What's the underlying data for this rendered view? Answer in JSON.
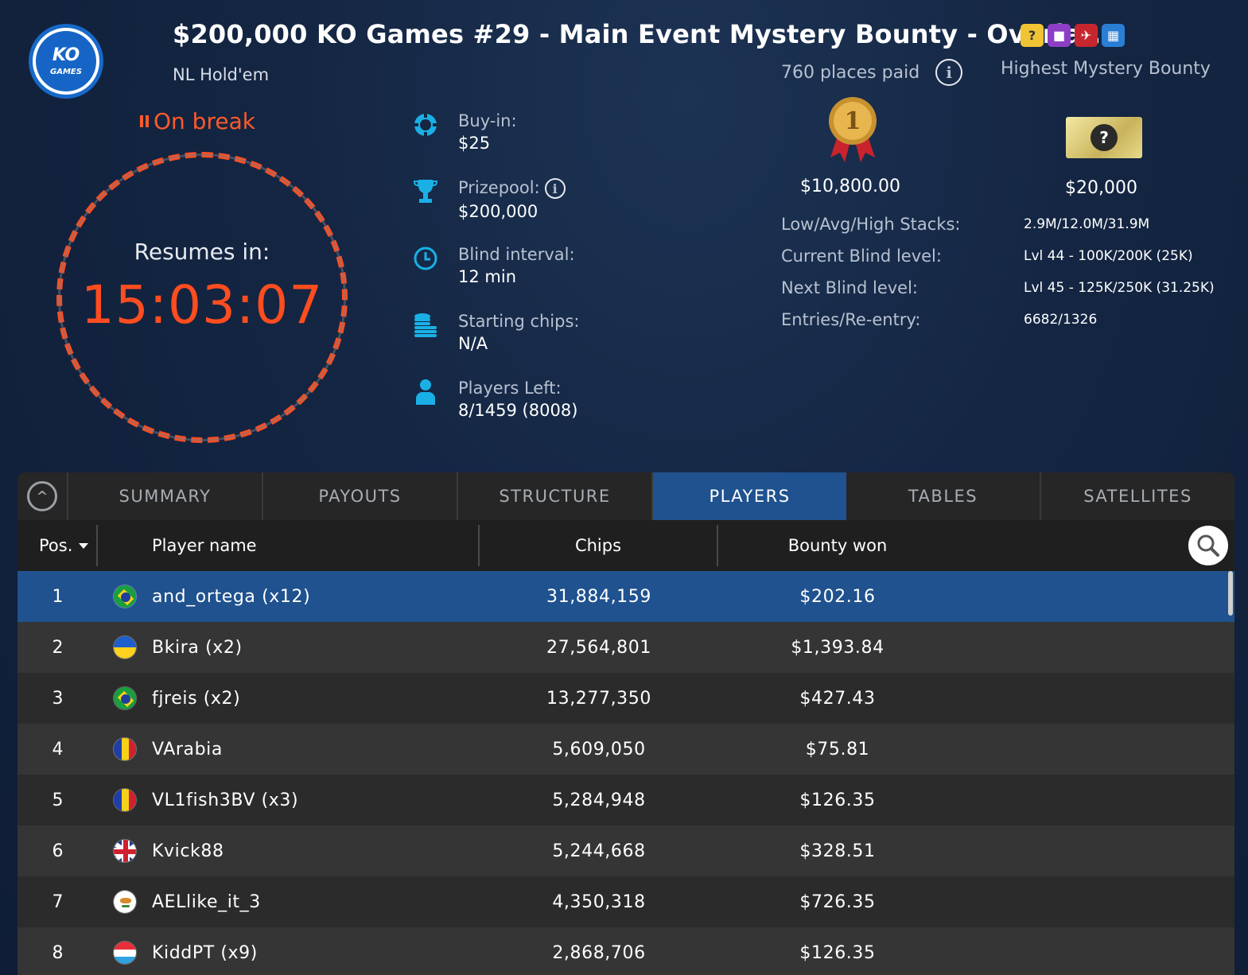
{
  "header": {
    "logo_text": "KO",
    "logo_sub": "GAMES",
    "title": "$200,000 KO Games #29 - Main Event Mystery Bounty - Overla...",
    "game_type": "NL Hold'em",
    "badges": [
      {
        "icon": "mystery-bounty-icon",
        "glyph": "?",
        "color": "#f1c435"
      },
      {
        "icon": "video-icon",
        "glyph": "■",
        "color": "#8c3fc4"
      },
      {
        "icon": "flight-icon",
        "glyph": "✈",
        "color": "#c8262e"
      },
      {
        "icon": "calendar-icon",
        "glyph": "▦",
        "color": "#2a7fd5"
      }
    ]
  },
  "status": {
    "label": "On break",
    "resumes_label": "Resumes in:",
    "countdown": "15:03:07"
  },
  "info": {
    "buyin_label": "Buy-in:",
    "buyin_value": "$25",
    "prizepool_label": "Prizepool:",
    "prizepool_value": "$200,000",
    "blind_label": "Blind interval:",
    "blind_value": "12 min",
    "chips_label": "Starting chips:",
    "chips_value": "N/A",
    "players_label": "Players Left:",
    "players_value": "8/1459 (8008)"
  },
  "prizes": {
    "places_paid": "760 places paid",
    "highest_bounty_label": "Highest Mystery Bounty",
    "medal_number": "1",
    "first_prize": "$10,800.00",
    "highest_bounty": "$20,000"
  },
  "stats": {
    "stacks_label": "Low/Avg/High Stacks:",
    "stacks_value": "2.9M/12.0M/31.9M",
    "current_label": "Current Blind level:",
    "current_value": "Lvl 44 - 100K/200K (25K)",
    "next_label": "Next Blind level:",
    "next_value": "Lvl 45 - 125K/250K (31.25K)",
    "entries_label": "Entries/Re-entry:",
    "entries_value": "6682/1326"
  },
  "tabs": [
    "SUMMARY",
    "PAYOUTS",
    "STRUCTURE",
    "PLAYERS",
    "TABLES",
    "SATELLITES"
  ],
  "active_tab": "PLAYERS",
  "table": {
    "headers": {
      "pos": "Pos.",
      "name": "Player name",
      "chips": "Chips",
      "bounty": "Bounty won"
    },
    "rows": [
      {
        "pos": "1",
        "flag": "brazil",
        "name": "and_ortega (x12)",
        "chips": "31,884,159",
        "bounty": "$202.16"
      },
      {
        "pos": "2",
        "flag": "ukraine",
        "name": "Bkira (x2)",
        "chips": "27,564,801",
        "bounty": "$1,393.84"
      },
      {
        "pos": "3",
        "flag": "brazil",
        "name": "fjreis (x2)",
        "chips": "13,277,350",
        "bounty": "$427.43"
      },
      {
        "pos": "4",
        "flag": "romania",
        "name": "VArabia",
        "chips": "5,609,050",
        "bounty": "$75.81"
      },
      {
        "pos": "5",
        "flag": "romania",
        "name": "VL1fish3BV (x3)",
        "chips": "5,284,948",
        "bounty": "$126.35"
      },
      {
        "pos": "6",
        "flag": "uk",
        "name": "Kvick88",
        "chips": "5,244,668",
        "bounty": "$328.51"
      },
      {
        "pos": "7",
        "flag": "cyprus",
        "name": "AELlike_it_3",
        "chips": "4,350,318",
        "bounty": "$726.35"
      },
      {
        "pos": "8",
        "flag": "luxembourg",
        "name": "KiddPT (x9)",
        "chips": "2,868,706",
        "bounty": "$126.35"
      }
    ]
  },
  "colors": {
    "accent_orange": "#ff4d1f",
    "active_tab_blue": "#1f528e",
    "icon_cyan": "#1ab0e6"
  }
}
